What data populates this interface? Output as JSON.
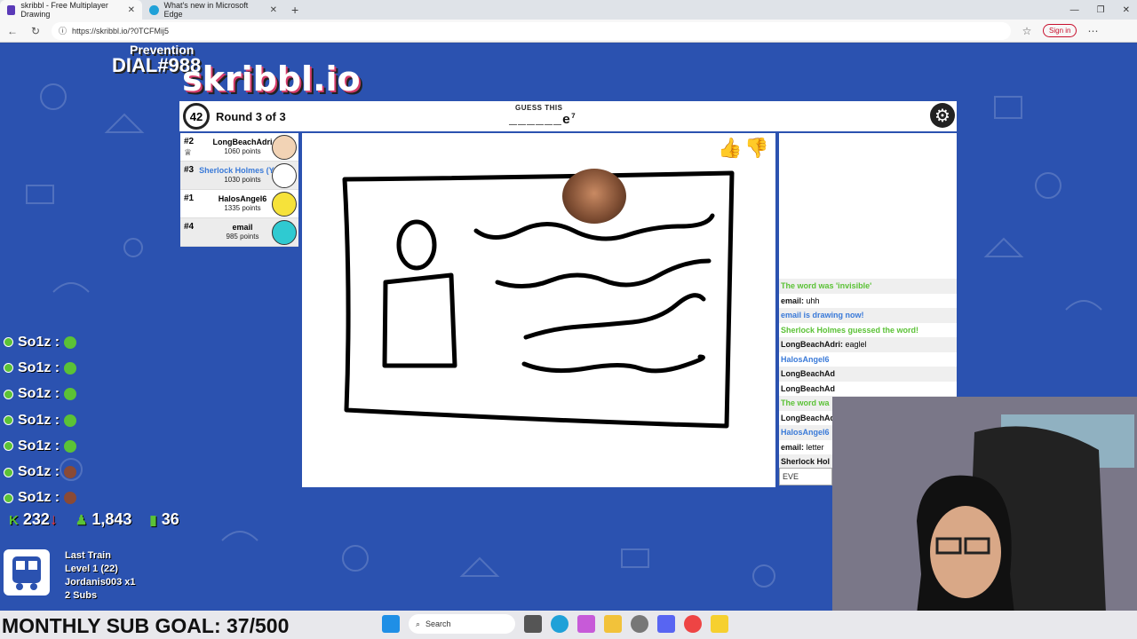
{
  "browser": {
    "tabs": [
      {
        "label": "skribbl - Free Multiplayer Drawing",
        "active": true
      },
      {
        "label": "What's new in Microsoft Edge",
        "active": false
      }
    ],
    "url": "https://skribbl.io/?0TCFMij5",
    "signin_label": "Sign in"
  },
  "logo": {
    "overlay_small": "Prevention",
    "overlay_main": "DIAL#988",
    "name": "skribbl.io"
  },
  "game": {
    "timer": "42",
    "round": "Round 3 of 3",
    "guess_label": "GUESS THIS",
    "word_mask": "______e",
    "word_len": "7"
  },
  "players": [
    {
      "rank": "#2",
      "name": "LongBeachAdri",
      "points": "1060 points",
      "avatar_color": "#f2d3b5"
    },
    {
      "rank": "#3",
      "name": "Sherlock Holmes (You)",
      "points": "1030 points",
      "avatar_color": "#ffffff",
      "name_color": "#3a7ad8"
    },
    {
      "rank": "#1",
      "name": "HalosAngel6",
      "points": "1335 points",
      "avatar_color": "#f6e23a"
    },
    {
      "rank": "#4",
      "name": "email",
      "points": "985 points",
      "avatar_color": "#2fcad1"
    }
  ],
  "chat": {
    "messages": [
      {
        "text": "The word was 'invisible'",
        "style": "green"
      },
      {
        "who": "email:",
        "text": "uhh",
        "style": "normal"
      },
      {
        "text": "email is drawing now!",
        "style": "blue"
      },
      {
        "text": "Sherlock Holmes guessed the word!",
        "style": "green"
      },
      {
        "who": "LongBeachAdri:",
        "text": "eaglel",
        "style": "normal"
      },
      {
        "text": "HalosAngel6",
        "style": "blue"
      },
      {
        "who": "LongBeachAd",
        "text": "",
        "style": "normal"
      },
      {
        "who": "LongBeachAd",
        "text": "",
        "style": "normal"
      },
      {
        "text": "The word wa",
        "style": "green"
      },
      {
        "who": "LongBeachAd",
        "text": "",
        "style": "normal"
      },
      {
        "text": "HalosAngel6",
        "style": "blue"
      },
      {
        "who": "email:",
        "text": "letter",
        "style": "normal"
      },
      {
        "who": "Sherlock Hol",
        "text": "",
        "style": "normal"
      }
    ],
    "input_value": "EVE"
  },
  "overlay": {
    "votes": [
      {
        "name": "So1z :",
        "face": "green"
      },
      {
        "name": "So1z :",
        "face": "green"
      },
      {
        "name": "So1z :",
        "face": "green"
      },
      {
        "name": "So1z :",
        "face": "green"
      },
      {
        "name": "So1z :",
        "face": "green"
      },
      {
        "name": "So1z :",
        "face": "brown"
      },
      {
        "name": "So1z :",
        "face": "brown"
      }
    ],
    "stat1": "232",
    "stat2": "1,843",
    "stat3": "36",
    "train_title": "Last Train",
    "train_level": "Level 1  (22)",
    "train_user": "Jordanis003 x1",
    "train_subs": "2 Subs",
    "goal": "MONTHLY SUB GOAL: 37/500"
  },
  "taskbar": {
    "search_label": "Search"
  }
}
